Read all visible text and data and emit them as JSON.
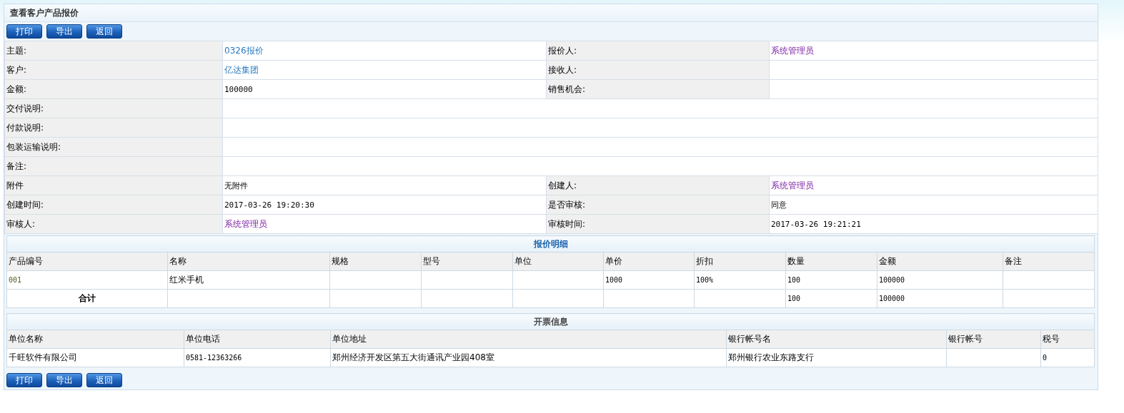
{
  "page_title": "查看客户产品报价",
  "top_buttons": [
    "打印",
    "导出",
    "返回"
  ],
  "form_rows": [
    {
      "fields": [
        {
          "label": "主题:",
          "value": "0326报价",
          "kind": "link"
        },
        {
          "label": "报价人:",
          "value": "系统管理员",
          "kind": "visited"
        }
      ]
    },
    {
      "fields": [
        {
          "label": "客户:",
          "value": "亿达集团",
          "kind": "link"
        },
        {
          "label": "接收人:"
        }
      ]
    },
    {
      "fields": [
        {
          "label": "金额:",
          "value": "100000",
          "kind": "mono"
        },
        {
          "label": "销售机会:"
        }
      ]
    },
    {
      "fields": [
        {
          "label": "交付说明:"
        }
      ]
    },
    {
      "fields": [
        {
          "label": "付款说明:"
        }
      ]
    },
    {
      "fields": [
        {
          "label": "包装运输说明:"
        }
      ]
    },
    {
      "fields": [
        {
          "label": "备注:"
        }
      ]
    },
    {
      "fields": [
        {
          "label": "附件",
          "value": "无附件",
          "kind": "text"
        },
        {
          "label": "创建人:",
          "value": "系统管理员",
          "kind": "visited"
        }
      ]
    },
    {
      "fields": [
        {
          "label": "创建时间:",
          "value": "2017-03-26 19:20:30",
          "kind": "mono"
        },
        {
          "label": "是否审核:",
          "value": "同意",
          "kind": "text"
        }
      ]
    },
    {
      "fields": [
        {
          "label": "审核人:",
          "value": "系统管理员",
          "kind": "visited"
        },
        {
          "label": "审核时间:",
          "value": "2017-03-26 19:21:21",
          "kind": "mono"
        }
      ]
    }
  ],
  "quote_details": {
    "title": "报价明细",
    "columns": [
      "产品编号",
      "名称",
      "规格",
      "型号",
      "单位",
      "单价",
      "折扣",
      "数量",
      "金额",
      "备注"
    ],
    "rows": [
      {
        "kind": "item",
        "cells": [
          "001",
          "红米手机",
          null,
          null,
          null,
          "1000",
          "100%",
          "100",
          "100000",
          null
        ]
      },
      {
        "kind": "total",
        "cells": [
          "合计",
          null,
          null,
          null,
          null,
          null,
          null,
          "100",
          "100000",
          null
        ]
      }
    ]
  },
  "invoice_info": {
    "title": "开票信息",
    "columns": [
      "单位名称",
      "单位电话",
      "单位地址",
      "银行帐号名",
      "银行帐号",
      "税号"
    ],
    "rows": [
      {
        "cells": [
          "千旺软件有限公司",
          "0581-12363266",
          "郑州经济开发区第五大街通讯产业园408室",
          "郑州银行农业东路支行",
          null,
          "0"
        ]
      }
    ]
  },
  "bottom_buttons": [
    "打印",
    "导出",
    "返回"
  ]
}
